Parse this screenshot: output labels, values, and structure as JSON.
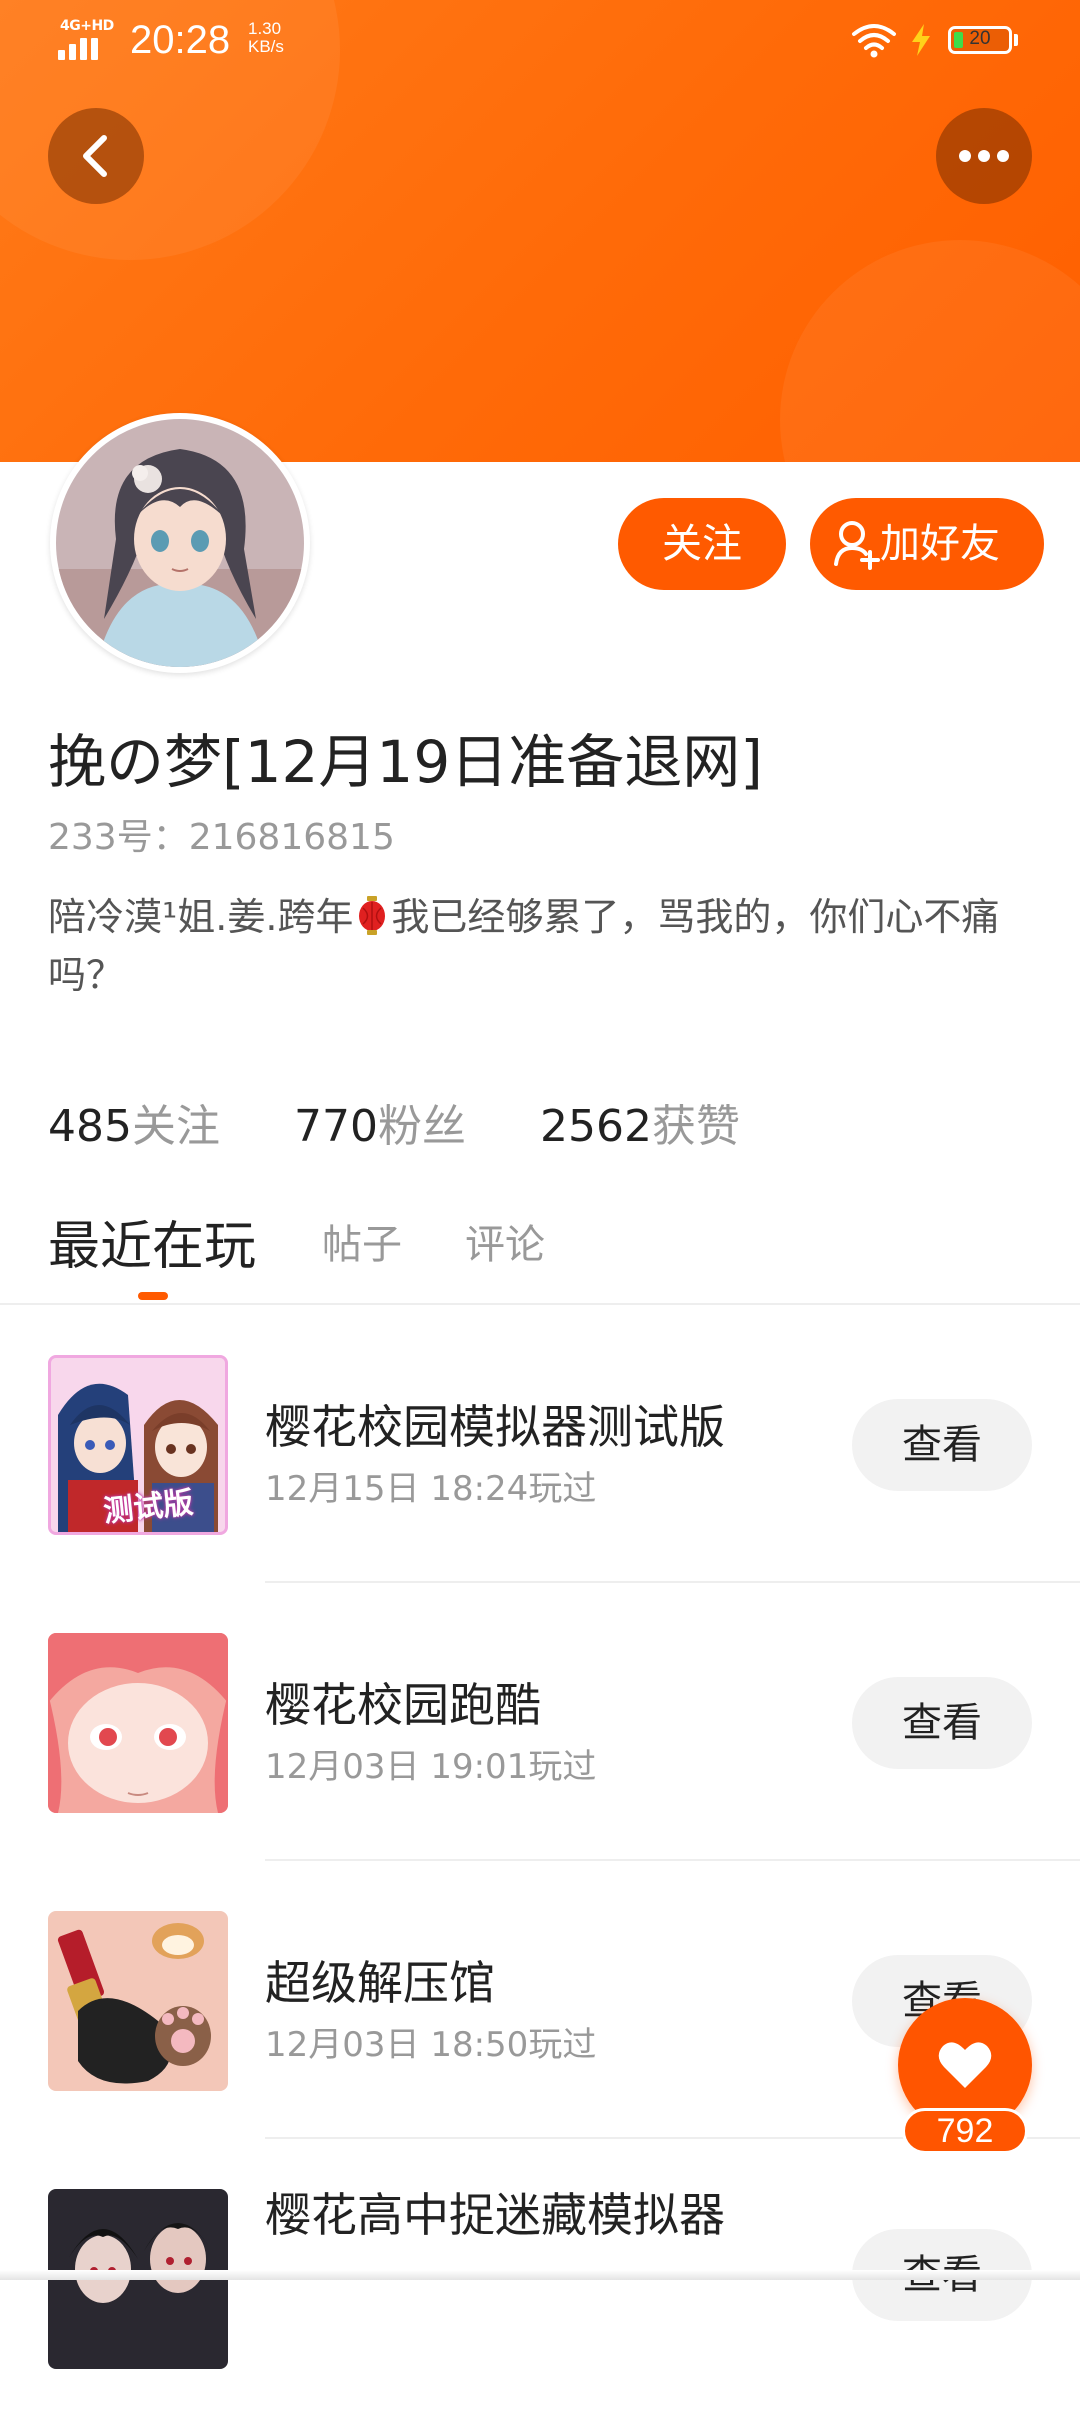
{
  "status_bar": {
    "network": "4G+HD",
    "time": "20:28",
    "speed_value": "1.30",
    "speed_unit": "KB/s",
    "battery_level": "20"
  },
  "header": {
    "background_color": "#ff6a08",
    "back_icon": "chevron-left-icon",
    "more_icon": "more-dots-icon"
  },
  "profile": {
    "follow_label": "关注",
    "add_friend_label": "加好友",
    "username": "挽の梦[12月19日准备退网]",
    "id_text": "233号：216816815",
    "bio_part1": "陪冷漠¹姐.姜.跨年",
    "bio_emoji": "red-lantern-icon",
    "bio_part2": "我已经够累了，骂我的，你们心不痛吗？"
  },
  "stats": [
    {
      "value": "485",
      "label": "关注"
    },
    {
      "value": "770",
      "label": "粉丝"
    },
    {
      "value": "2562",
      "label": "获赞"
    }
  ],
  "tabs": [
    {
      "label": "最近在玩",
      "active": true
    },
    {
      "label": "帖子",
      "active": false
    },
    {
      "label": "评论",
      "active": false
    }
  ],
  "games": [
    {
      "title": "樱花校园模拟器测试版",
      "time": "12月15日 18:24玩过",
      "button": "查看",
      "badge": "测试版"
    },
    {
      "title": "樱花校园跑酷",
      "time": "12月03日 19:01玩过",
      "button": "查看"
    },
    {
      "title": "超级解压馆",
      "time": "12月03日 18:50玩过",
      "button": "查看"
    },
    {
      "title": "樱花高中捉迷藏模拟器",
      "time": "",
      "button": "查看"
    }
  ],
  "fab": {
    "icon": "heart-icon",
    "count": "792"
  },
  "colors": {
    "accent": "#ff5a00",
    "text_primary": "#222222",
    "text_secondary": "#999999"
  }
}
